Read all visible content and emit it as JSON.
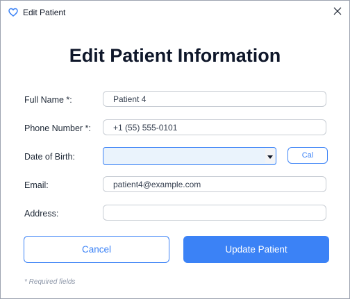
{
  "window": {
    "title": "Edit Patient",
    "app_icon": "heart-tooth-icon",
    "close_icon": "close-icon"
  },
  "form": {
    "heading": "Edit Patient Information",
    "fields": {
      "full_name": {
        "label": "Full Name *:",
        "value": "Patient 4"
      },
      "phone": {
        "label": "Phone Number *:",
        "value": "+1 (55) 555-0101"
      },
      "dob": {
        "label": "Date of Birth:",
        "value": ""
      },
      "email": {
        "label": "Email:",
        "value": "patient4@example.com"
      },
      "address": {
        "label": "Address:",
        "value": ""
      }
    },
    "calendar_button": "Cal",
    "cancel_button": "Cancel",
    "submit_button": "Update Patient",
    "footnote": "* Required fields"
  },
  "colors": {
    "accent": "#3b82f6",
    "heading": "#0f172a",
    "muted": "#8a94a6"
  }
}
